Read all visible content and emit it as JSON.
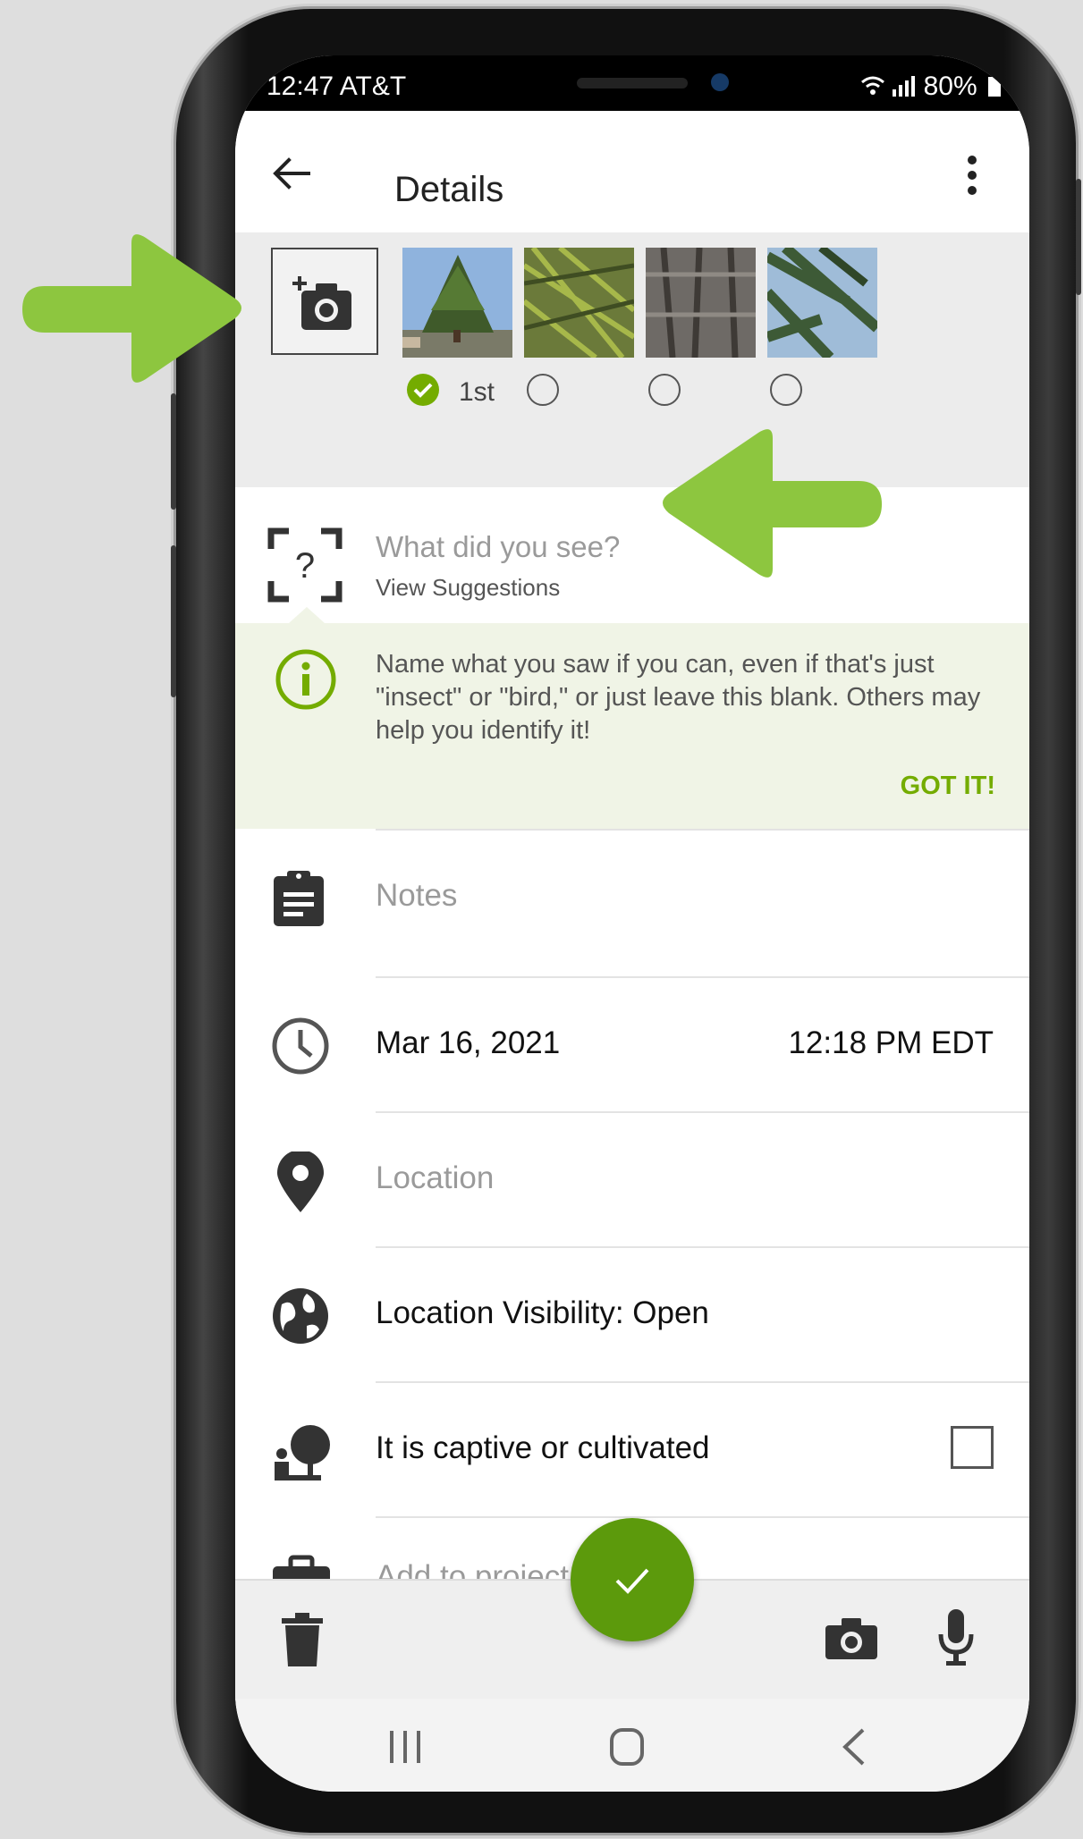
{
  "statusbar": {
    "time": "12:47 AT&T",
    "battery": "80%"
  },
  "appbar": {
    "title": "Details",
    "back_icon": "arrow-left-icon",
    "menu_icon": "more-vert-icon"
  },
  "photos": {
    "add_icon": "add-photo-icon",
    "first_label": "1st",
    "thumbnails": [
      {
        "subject": "spruce-tree",
        "selected": true
      },
      {
        "subject": "spruce-branch",
        "selected": false
      },
      {
        "subject": "bark",
        "selected": false
      },
      {
        "subject": "branches-sky",
        "selected": false
      }
    ]
  },
  "identification": {
    "placeholder": "What did you see?",
    "suggestions_label": "View Suggestions",
    "icon": "species-unknown-icon"
  },
  "tip": {
    "text": "Name what you saw if you can, even if that's just \"insect\" or \"bird,\" or just leave this blank. Others may help you identify it!",
    "action": "GOT IT!",
    "icon": "info-icon"
  },
  "fields": {
    "notes": "Notes",
    "date": "Mar 16, 2021",
    "time": "12:18 PM EDT",
    "location": "Location",
    "visibility": "Location Visibility: Open",
    "captive": "It is captive or cultivated",
    "captive_checked": false,
    "projects": "Add to project(s)"
  },
  "bottombar": {
    "delete_icon": "trash-icon",
    "camera_icon": "camera-icon",
    "mic_icon": "mic-icon",
    "confirm_icon": "check-icon"
  },
  "navbar": {
    "recent_icon": "recent-apps-icon",
    "home_icon": "home-icon",
    "back_icon": "back-chevron-icon"
  },
  "colors": {
    "accent": "#74ac00",
    "fab": "#5c9a0c",
    "tip_bg": "#f0f4e6",
    "annotation_arrow": "#8dc63f"
  }
}
